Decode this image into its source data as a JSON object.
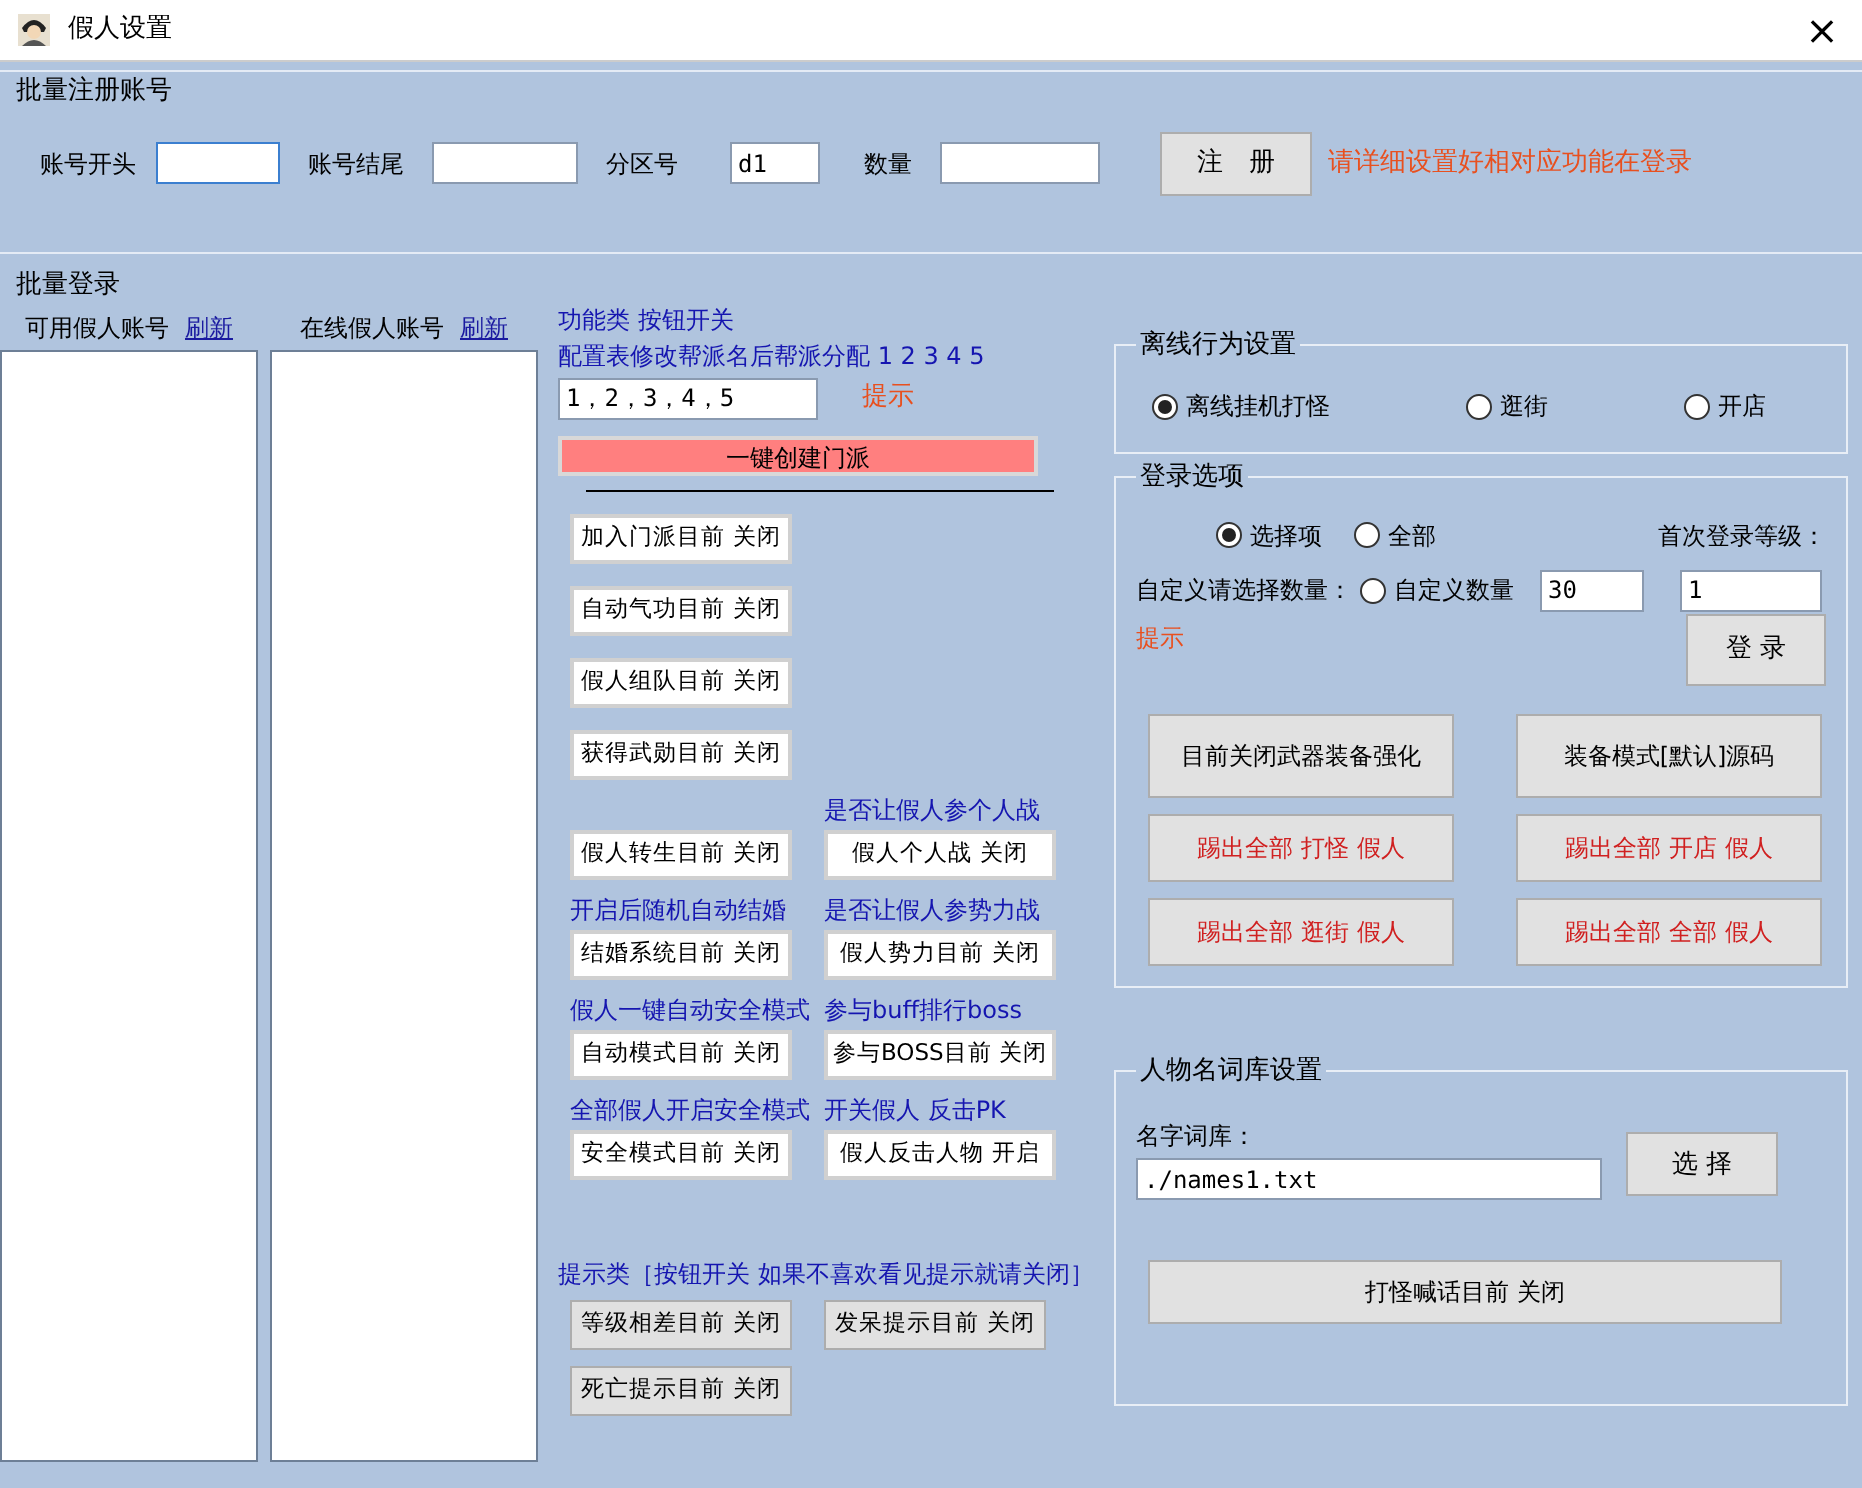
{
  "window": {
    "title": "假人设置",
    "close": "×"
  },
  "register": {
    "legend": "批量注册账号",
    "fields": [
      {
        "label": "账号开头",
        "kind": "short"
      },
      {
        "label": "账号结尾",
        "kind": "medium"
      },
      {
        "label": "分区号",
        "value": "d1",
        "kind": "tiny"
      },
      {
        "label": "数量",
        "kind": "wide"
      }
    ],
    "button": "注　册",
    "note": "请详细设置好相对应功能在登录"
  },
  "login": {
    "legend": "批量登录",
    "lists": [
      {
        "label": "可用假人账号",
        "refresh": "刷新"
      },
      {
        "label": "在线假人账号",
        "refresh": "刷新"
      }
    ]
  },
  "functions": {
    "heading": "功能类 按钮开关",
    "config_label": "配置表修改帮派名后帮派分配 1 2 3 4 5",
    "config_value": "1，2，3，4，5",
    "hint": "提示",
    "create_button": "一键创建门派",
    "rows": [
      {
        "left": {
          "button": "加入门派目前 关闭"
        }
      },
      {
        "left": {
          "button": "自动气功目前 关闭"
        }
      },
      {
        "left": {
          "button": "假人组队目前 关闭"
        }
      },
      {
        "left": {
          "button": "获得武勋目前 关闭"
        }
      },
      {
        "left": {
          "button": "假人转生目前 关闭"
        },
        "right": {
          "caption": "是否让假人参个人战",
          "button": "假人个人战 关闭"
        }
      },
      {
        "left": {
          "caption": "开启后随机自动结婚",
          "button": "结婚系统目前 关闭"
        },
        "right": {
          "caption": "是否让假人参势力战",
          "button": "假人势力目前 关闭"
        }
      },
      {
        "left": {
          "caption": "假人一键自动安全模式",
          "button": "自动模式目前 关闭"
        },
        "right": {
          "caption": "参与buff排行boss",
          "button": "参与BOSS目前 关闭"
        }
      },
      {
        "left": {
          "caption": "全部假人开启安全模式",
          "button": "安全模式目前 关闭"
        },
        "right": {
          "caption": "开关假人 反击PK",
          "button": "假人反击人物 开启"
        }
      }
    ]
  },
  "hints": {
    "heading": "提示类［按钮开关 如果不喜欢看见提示就请关闭］",
    "buttons": [
      "等级相差目前 关闭",
      "发呆提示目前 关闭",
      "死亡提示目前 关闭"
    ]
  },
  "offline": {
    "legend": "离线行为设置",
    "options": [
      {
        "label": "离线挂机打怪",
        "selected": true
      },
      {
        "label": "逛街",
        "selected": false
      },
      {
        "label": "开店",
        "selected": false
      }
    ]
  },
  "login_options": {
    "legend": "登录选项",
    "modes": [
      {
        "label": "选择项",
        "selected": true
      },
      {
        "label": "全部",
        "selected": false
      }
    ],
    "level_label": "首次登录等级：",
    "custom_label": "自定义请选择数量：",
    "custom": {
      "label": "自定义数量",
      "selected": false
    },
    "count": "30",
    "level": "1",
    "hint": "提示",
    "login_button": "登 录",
    "actions": [
      {
        "label": "目前关闭武器装备强化",
        "kind": "normal"
      },
      {
        "label": "装备模式[默认]源码",
        "kind": "normal"
      },
      {
        "label": "踢出全部 打怪 假人",
        "kind": "kick"
      },
      {
        "label": "踢出全部 开店 假人",
        "kind": "kick"
      },
      {
        "label": "踢出全部 逛街 假人",
        "kind": "kick"
      },
      {
        "label": "踢出全部 全部 假人",
        "kind": "kick"
      }
    ]
  },
  "names": {
    "legend": "人物名词库设置",
    "label": "名字词库：",
    "value": "./names1.txt",
    "choose": "选 择",
    "shout_button": "打怪喊话目前 关闭"
  }
}
